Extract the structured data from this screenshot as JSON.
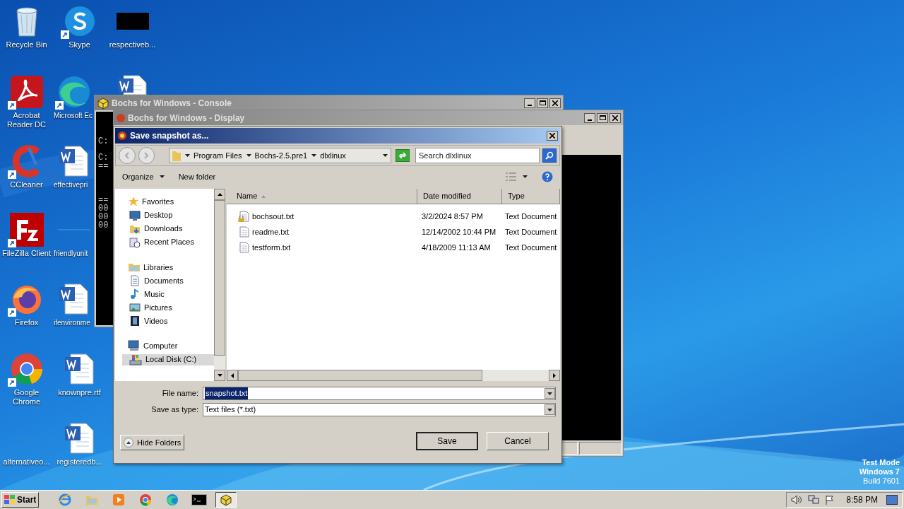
{
  "desktop_columns": [
    [
      {
        "label": "Recycle Bin",
        "kind": "recycle",
        "shortcut": false
      },
      {
        "label": "Acrobat Reader DC",
        "kind": "acrobat",
        "shortcut": true
      },
      {
        "label": "CCleaner",
        "kind": "ccleaner",
        "shortcut": true
      },
      {
        "label": "FileZilla Client",
        "kind": "filezilla",
        "shortcut": true
      },
      {
        "label": "Firefox",
        "kind": "firefox",
        "shortcut": true
      },
      {
        "label": "Google Chrome",
        "kind": "chrome",
        "shortcut": true
      },
      {
        "label": "alternativeo...",
        "kind": "blank",
        "shortcut": false
      }
    ],
    [
      {
        "label": "Skype",
        "kind": "skype",
        "shortcut": true
      },
      {
        "label": "Microsoft Ec",
        "kind": "edge",
        "shortcut": true
      },
      {
        "label": "effectivepri",
        "kind": "word",
        "shortcut": false
      },
      {
        "label": "friendlyunit",
        "kind": "blank",
        "shortcut": false
      },
      {
        "label": "ifenvironme",
        "kind": "word",
        "shortcut": false
      },
      {
        "label": "knownpre.rtf",
        "kind": "word",
        "shortcut": false
      },
      {
        "label": "registeredb...",
        "kind": "word",
        "shortcut": false
      }
    ],
    [
      {
        "label": "respectiveb...",
        "kind": "black",
        "shortcut": false
      },
      {
        "kind": "wordtop",
        "shortcut": false
      }
    ]
  ],
  "console": {
    "title": "Bochs for Windows - Console",
    "lines": [
      "C:",
      "C:",
      "==",
      "==",
      "00",
      "00",
      "00"
    ]
  },
  "display": {
    "title": "Bochs for Windows - Display"
  },
  "dialog": {
    "title": "Save snapshot as...",
    "breadcrumb": [
      "Program Files",
      "Bochs-2.5.pre1",
      "dlxlinux"
    ],
    "search": {
      "placeholder": "Search dlxlinux"
    },
    "toolbar": {
      "organize": "Organize",
      "new_folder": "New folder"
    },
    "nav": [
      {
        "label": "Favorites",
        "kind": "star",
        "children": [
          {
            "label": "Desktop",
            "kind": "desktop",
            "selected": false
          },
          {
            "label": "Downloads",
            "kind": "downloads",
            "selected": false
          },
          {
            "label": "Recent Places",
            "kind": "recent",
            "selected": false
          }
        ]
      },
      {
        "label": "Libraries",
        "kind": "library",
        "children": [
          {
            "label": "Documents",
            "kind": "documents",
            "selected": false
          },
          {
            "label": "Music",
            "kind": "music",
            "selected": false
          },
          {
            "label": "Pictures",
            "kind": "pictures",
            "selected": false
          },
          {
            "label": "Videos",
            "kind": "videos",
            "selected": false
          }
        ]
      },
      {
        "label": "Computer",
        "kind": "computer",
        "children": [
          {
            "label": "Local Disk (C:)",
            "kind": "disk",
            "selected": true
          }
        ]
      }
    ],
    "columns": [
      {
        "label": "Name",
        "sorted": true
      },
      {
        "label": "Date modified",
        "sorted": false
      },
      {
        "label": "Type",
        "sorted": false
      }
    ],
    "files": [
      {
        "name": "bochsout.txt",
        "date": "3/2/2024 8:57 PM",
        "type": "Text Document",
        "locked": true
      },
      {
        "name": "readme.txt",
        "date": "12/14/2002 10:44 PM",
        "type": "Text Document",
        "locked": false
      },
      {
        "name": "testform.txt",
        "date": "4/18/2009 11:13 AM",
        "type": "Text Document",
        "locked": false
      }
    ],
    "file_name_label": "File name:",
    "file_name": "snapshot.txt",
    "type_label": "Save as type:",
    "file_type": "Text files (*.txt)",
    "hide_folders": "Hide Folders",
    "save": "Save",
    "cancel": "Cancel"
  },
  "taskbar": {
    "start": "Start",
    "items": [
      {
        "kind": "ie",
        "active": false
      },
      {
        "kind": "explorer",
        "active": false
      },
      {
        "kind": "media",
        "active": false
      },
      {
        "kind": "chrome",
        "active": false
      },
      {
        "kind": "edge",
        "active": false
      },
      {
        "kind": "cmd",
        "active": false
      },
      {
        "kind": "bochs",
        "active": true
      }
    ],
    "clock": "8:58 PM"
  },
  "os_notice": [
    "Test Mode",
    "Windows 7",
    "Build 7601"
  ]
}
